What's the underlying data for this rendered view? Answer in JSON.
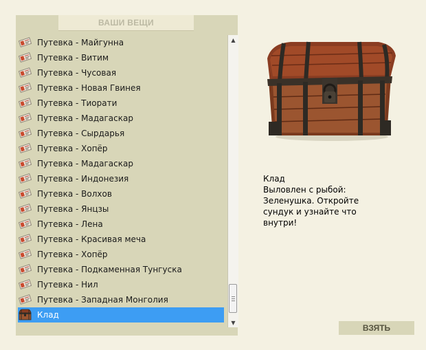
{
  "panel": {
    "title": "ВАШИ ВЕЩИ"
  },
  "items": [
    {
      "label": "Путевка - Майгунна",
      "icon": "ticket-icon"
    },
    {
      "label": "Путевка - Витим",
      "icon": "ticket-icon"
    },
    {
      "label": "Путевка - Чусовая",
      "icon": "ticket-icon"
    },
    {
      "label": "Путевка - Новая Гвинея",
      "icon": "ticket-icon"
    },
    {
      "label": "Путевка - Тиорати",
      "icon": "ticket-icon"
    },
    {
      "label": "Путевка - Мадагаскар",
      "icon": "ticket-icon"
    },
    {
      "label": "Путевка - Сырдарья",
      "icon": "ticket-icon"
    },
    {
      "label": "Путевка - Хопёр",
      "icon": "ticket-icon"
    },
    {
      "label": "Путевка - Мадагаскар",
      "icon": "ticket-icon"
    },
    {
      "label": "Путевка - Индонезия",
      "icon": "ticket-icon"
    },
    {
      "label": "Путевка - Волхов",
      "icon": "ticket-icon"
    },
    {
      "label": "Путевка - Янцзы",
      "icon": "ticket-icon"
    },
    {
      "label": "Путевка - Лена",
      "icon": "ticket-icon"
    },
    {
      "label": "Путевка - Красивая меча",
      "icon": "ticket-icon"
    },
    {
      "label": "Путевка - Хопёр",
      "icon": "ticket-icon"
    },
    {
      "label": "Путевка - Подкаменная Тунгуска",
      "icon": "ticket-icon"
    },
    {
      "label": "Путевка - Нил",
      "icon": "ticket-icon"
    },
    {
      "label": "Путевка - Западная Монголия",
      "icon": "ticket-icon"
    },
    {
      "label": "Клад",
      "icon": "chest-icon",
      "selected": true
    }
  ],
  "detail": {
    "name": "Клад",
    "line1": "Выловлен с рыбой:",
    "line2": "Зеленушка. Откройте",
    "line3": "сундук и узнайте что",
    "line4": "внутри!"
  },
  "actions": {
    "take_label": "ВЗЯТЬ"
  },
  "icons": {
    "scroll_up": "arrow-up-icon",
    "scroll_down": "arrow-down-icon"
  },
  "colors": {
    "selection": "#3d9df3",
    "panel_bg": "#d8d6b8",
    "page_bg": "#f4f1e2"
  }
}
